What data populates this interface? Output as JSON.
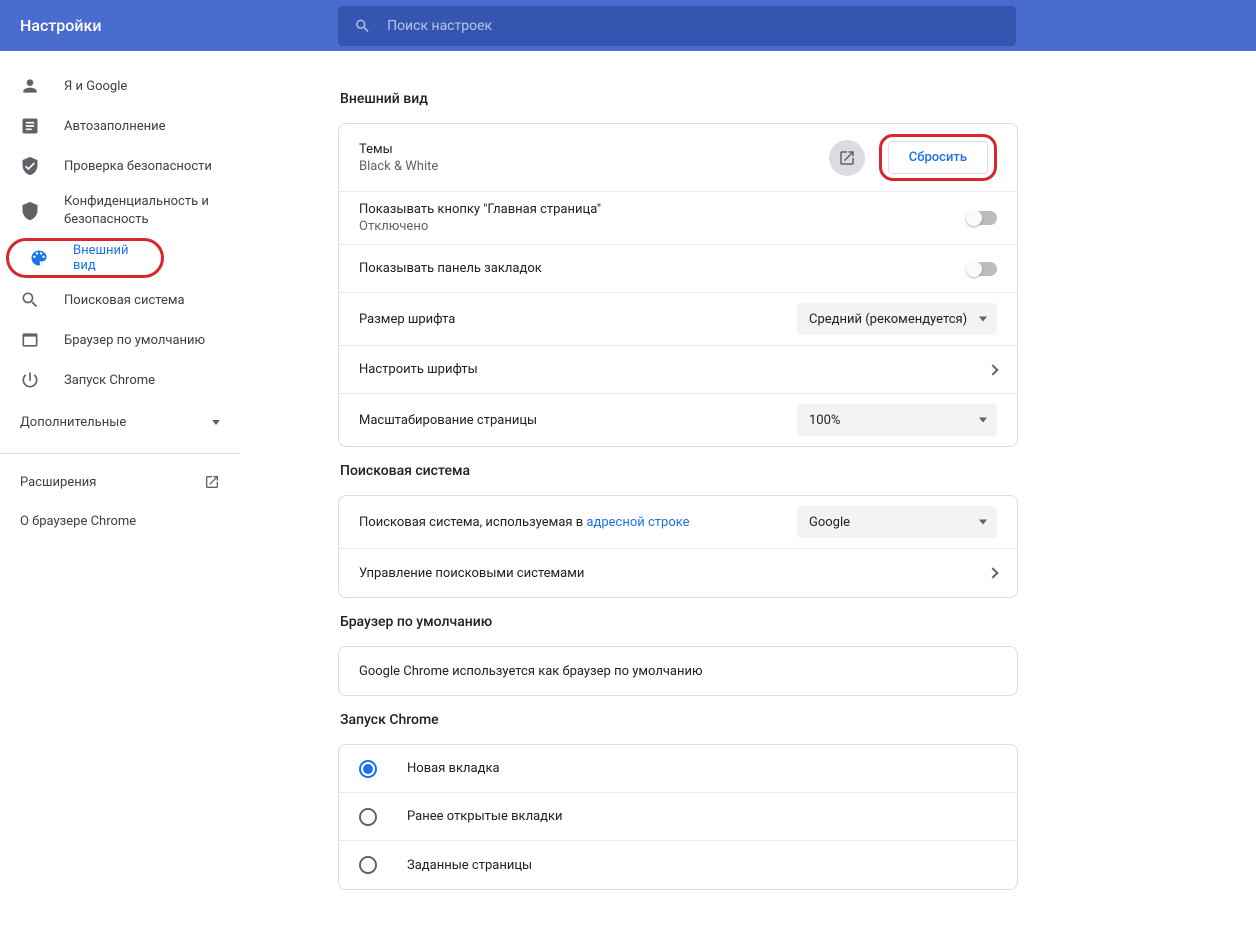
{
  "header": {
    "title": "Настройки",
    "search_placeholder": "Поиск настроек"
  },
  "nav": {
    "items": [
      {
        "label": "Я и Google"
      },
      {
        "label": "Автозаполнение"
      },
      {
        "label": "Проверка безопасности"
      },
      {
        "label": "Конфиденциальность и",
        "label2": "безопасность"
      },
      {
        "label": "Внешний вид"
      },
      {
        "label": "Поисковая система"
      },
      {
        "label": "Браузер по умолчанию"
      },
      {
        "label": "Запуск Chrome"
      }
    ],
    "advanced": "Дополнительные",
    "extensions": "Расширения",
    "about": "О браузере Chrome"
  },
  "sections": {
    "appearance": {
      "title": "Внешний вид",
      "themes_label": "Темы",
      "themes_value": "Black & White",
      "reset_btn": "Сбросить",
      "home_button_label": "Показывать кнопку \"Главная страница\"",
      "home_button_status": "Отключено",
      "bookmarks_bar": "Показывать панель закладок",
      "font_size_label": "Размер шрифта",
      "font_size_value": "Средний (рекомендуется)",
      "customize_fonts": "Настроить шрифты",
      "page_zoom_label": "Масштабирование страницы",
      "page_zoom_value": "100%"
    },
    "search": {
      "title": "Поисковая система",
      "engine_label_prefix": "Поисковая система, используемая в ",
      "engine_label_link": "адресной строке",
      "engine_value": "Google",
      "manage": "Управление поисковыми системами"
    },
    "default_browser": {
      "title": "Браузер по умолчанию",
      "status": "Google Chrome используется как браузер по умолчанию"
    },
    "startup": {
      "title": "Запуск Chrome",
      "opts": [
        "Новая вкладка",
        "Ранее открытые вкладки",
        "Заданные страницы"
      ]
    }
  }
}
